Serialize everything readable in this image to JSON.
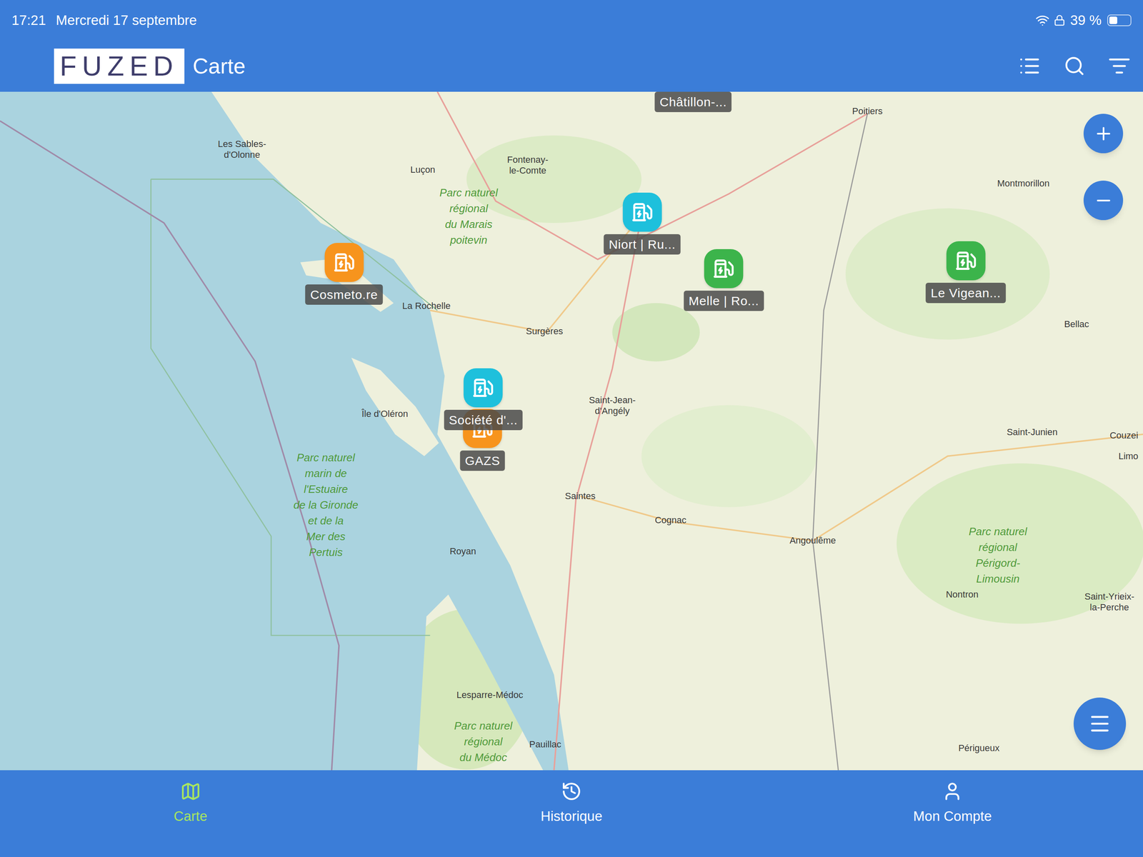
{
  "status_bar": {
    "time": "17:21",
    "date": "Mercredi 17 septembre",
    "battery": "39 %",
    "battery_level": 0.39
  },
  "app_bar": {
    "logo": "FUZED",
    "title": "Carte"
  },
  "map": {
    "pins": [
      {
        "label": "Châtillon-...",
        "color": "#1ec0dc",
        "kind": "edge"
      },
      {
        "label": "Cosmeto.re",
        "color": "#f7941d",
        "kind": "pin"
      },
      {
        "label": "Niort | Ru...",
        "color": "#1ec0dc",
        "kind": "pin"
      },
      {
        "label": "Melle | Ro...",
        "color": "#3cb44b",
        "kind": "pin"
      },
      {
        "label": "Le Vigean...",
        "color": "#3cb44b",
        "kind": "pin"
      },
      {
        "label": "GAZS",
        "color": "#f7941d",
        "kind": "pin"
      },
      {
        "label": "Société d'...",
        "color": "#1ec0dc",
        "kind": "pin"
      }
    ],
    "places": [
      {
        "lines": [
          "Les Sables-",
          "d'Olonne"
        ]
      },
      {
        "lines": [
          "Luçon"
        ]
      },
      {
        "lines": [
          "Fontenay-",
          "le-Comte"
        ]
      },
      {
        "lines": [
          "Poitiers"
        ]
      },
      {
        "lines": [
          "Montmorillon"
        ]
      },
      {
        "lines": [
          "La Rochelle"
        ]
      },
      {
        "lines": [
          "Surgères"
        ]
      },
      {
        "lines": [
          "Bellac"
        ]
      },
      {
        "lines": [
          "Saint-Jean-",
          "d'Angély"
        ]
      },
      {
        "lines": [
          "Île d'Oléron"
        ]
      },
      {
        "lines": [
          "Saint-Junien"
        ]
      },
      {
        "lines": [
          "Couzei"
        ]
      },
      {
        "lines": [
          "Limo"
        ]
      },
      {
        "lines": [
          "Saintes"
        ]
      },
      {
        "lines": [
          "Cognac"
        ]
      },
      {
        "lines": [
          "Angoulême"
        ]
      },
      {
        "lines": [
          "Royan"
        ]
      },
      {
        "lines": [
          "Nontron"
        ]
      },
      {
        "lines": [
          "Saint-Yrieix-",
          "la-Perche"
        ]
      },
      {
        "lines": [
          "Lesparre-Médoc"
        ]
      },
      {
        "lines": [
          "Pauillac"
        ]
      },
      {
        "lines": [
          "Périgueux"
        ]
      }
    ],
    "parks": [
      {
        "lines": [
          "Parc naturel",
          "régional",
          "du Marais",
          "poitevin"
        ]
      },
      {
        "lines": [
          "Parc naturel",
          "marin de",
          "l'Estuaire",
          "de la Gironde",
          "et de la",
          "Mer des",
          "Pertuis"
        ]
      },
      {
        "lines": [
          "Parc naturel",
          "régional",
          "Périgord-",
          "Limousin"
        ]
      },
      {
        "lines": [
          "Parc naturel",
          "régional",
          "du Médoc"
        ]
      }
    ]
  },
  "nav": [
    {
      "label": "Carte",
      "selected": true
    },
    {
      "label": "Historique",
      "selected": false
    },
    {
      "label": "Mon Compte",
      "selected": false
    }
  ]
}
